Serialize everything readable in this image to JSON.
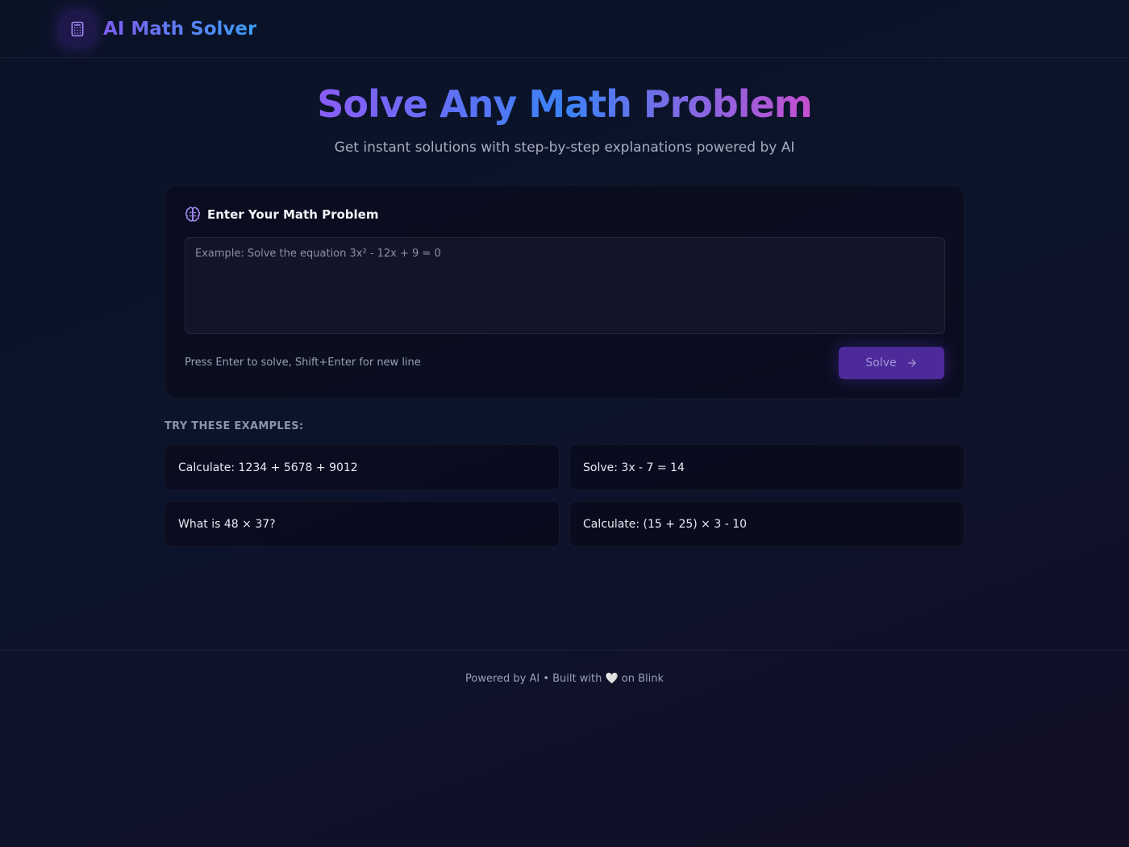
{
  "header": {
    "app_title": "AI Math Solver",
    "logo_icon": "calculator-icon"
  },
  "hero": {
    "title": "Solve Any Math Problem",
    "subtitle": "Get instant solutions with step-by-step explanations powered by AI"
  },
  "input_card": {
    "title": "Enter Your Math Problem",
    "title_icon": "brain-icon",
    "placeholder": "Example: Solve the equation 3x² - 12x + 9 = 0",
    "value": "",
    "hint": "Press Enter to solve, Shift+Enter for new line",
    "solve_label": "Solve",
    "solve_icon": "arrow-right-icon"
  },
  "examples": {
    "label": "TRY THESE EXAMPLES:",
    "items": [
      "Calculate: 1234 + 5678 + 9012",
      "Solve: 3x - 7 = 14",
      "What is 48 × 37?",
      "Calculate: (15 + 25) × 3 - 10"
    ]
  },
  "footer": {
    "text": "Powered by AI • Built with 🤍 on Blink"
  },
  "colors": {
    "accent_purple": "#7c3aed",
    "accent_blue": "#3b82f6",
    "accent_pink": "#c64fd0",
    "solve_button": "#4c2a9a",
    "background": "#0a1226"
  }
}
